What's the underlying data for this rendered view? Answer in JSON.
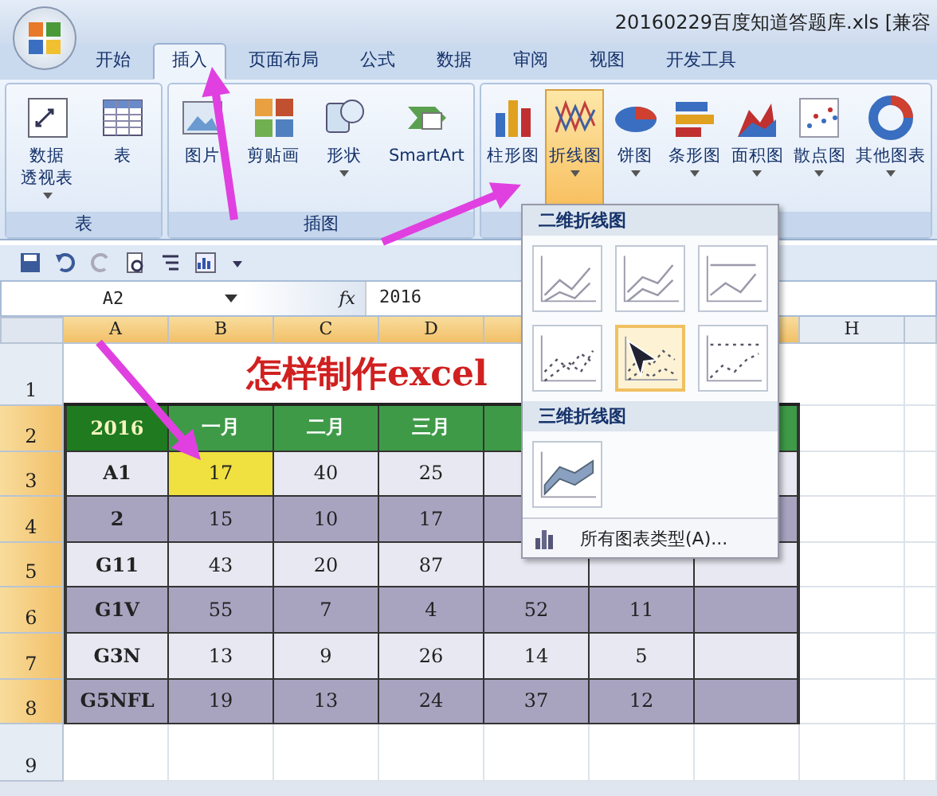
{
  "window": {
    "title": "20160229百度知道答题库.xls [兼容"
  },
  "tabs": [
    {
      "label": "开始",
      "selected": false
    },
    {
      "label": "插入",
      "selected": true
    },
    {
      "label": "页面布局",
      "selected": false
    },
    {
      "label": "公式",
      "selected": false
    },
    {
      "label": "数据",
      "selected": false
    },
    {
      "label": "审阅",
      "selected": false
    },
    {
      "label": "视图",
      "selected": false
    },
    {
      "label": "开发工具",
      "selected": false
    }
  ],
  "ribbon": {
    "groups": [
      {
        "label": "表",
        "buttons": [
          {
            "lines": [
              "数据",
              "透视表"
            ],
            "kind": "pivot",
            "dropdown": true,
            "selected": false
          },
          {
            "label": "表",
            "kind": "table",
            "dropdown": false,
            "selected": false
          }
        ]
      },
      {
        "label": "插图",
        "buttons": [
          {
            "label": "图片",
            "kind": "picture",
            "dropdown": false,
            "selected": false
          },
          {
            "label": "剪贴画",
            "kind": "clipart",
            "dropdown": false,
            "selected": false
          },
          {
            "label": "形状",
            "kind": "shapes",
            "dropdown": true,
            "selected": false
          },
          {
            "label": "SmartArt",
            "kind": "smartart",
            "dropdown": false,
            "selected": false
          }
        ]
      },
      {
        "buttons": [
          {
            "label": "柱形图",
            "kind": "column",
            "dropdown": false,
            "selected": false
          },
          {
            "label": "折线图",
            "kind": "line",
            "dropdown": true,
            "selected": true
          },
          {
            "label": "饼图",
            "kind": "pie",
            "dropdown": true,
            "selected": false
          },
          {
            "label": "条形图",
            "kind": "bar",
            "dropdown": true,
            "selected": false
          },
          {
            "label": "面积图",
            "kind": "area",
            "dropdown": true,
            "selected": false
          },
          {
            "label": "散点图",
            "kind": "scatter",
            "dropdown": true,
            "selected": false
          },
          {
            "label": "其他图表",
            "kind": "other",
            "dropdown": true,
            "selected": false
          }
        ]
      }
    ]
  },
  "formula_bar": {
    "name_box": "A2",
    "fx": "fx",
    "value": "2016"
  },
  "sheet": {
    "columns": [
      {
        "label": "A",
        "selected": true
      },
      {
        "label": "B",
        "selected": true
      },
      {
        "label": "C",
        "selected": true
      },
      {
        "label": "D",
        "selected": true
      },
      {
        "selected": true
      },
      {
        "label": "H",
        "selected": false
      }
    ],
    "title": "怎样制作excel",
    "rows": [
      {
        "header": "1",
        "selected": false,
        "kind": "title"
      },
      {
        "header": "2",
        "selected": true,
        "kind": "header",
        "cells": [
          {
            "text": "2016",
            "highlighted": false
          },
          {
            "text": "一月",
            "highlighted": false
          },
          {
            "text": "二月",
            "highlighted": false
          },
          {
            "text": "三月",
            "highlighted": false
          }
        ]
      },
      {
        "header": "3",
        "selected": true,
        "kind": "light",
        "cells": [
          {
            "text": "A1",
            "highlighted": false
          },
          {
            "text": "17",
            "highlighted": true
          },
          {
            "text": "40",
            "highlighted": false
          },
          {
            "text": "25",
            "highlighted": false
          }
        ]
      },
      {
        "header": "4",
        "selected": true,
        "kind": "dark",
        "cells": [
          {
            "text": "2",
            "highlighted": false
          },
          {
            "text": "15",
            "highlighted": false
          },
          {
            "text": "10",
            "highlighted": false
          },
          {
            "text": "17",
            "highlighted": false
          }
        ]
      },
      {
        "header": "5",
        "selected": true,
        "kind": "light",
        "cells": [
          {
            "text": "G11",
            "highlighted": false
          },
          {
            "text": "43",
            "highlighted": false
          },
          {
            "text": "20",
            "highlighted": false
          },
          {
            "text": "87",
            "highlighted": false
          }
        ]
      },
      {
        "header": "6",
        "selected": true,
        "kind": "dark",
        "cells": [
          {
            "text": "G1V",
            "highlighted": false
          },
          {
            "text": "55",
            "highlighted": false
          },
          {
            "text": "7",
            "highlighted": false
          },
          {
            "text": "4",
            "highlighted": false
          },
          {
            "text": "52",
            "highlighted": false
          },
          {
            "text": "11",
            "highlighted": false
          }
        ]
      },
      {
        "header": "7",
        "selected": true,
        "kind": "light",
        "cells": [
          {
            "text": "G3N",
            "highlighted": false
          },
          {
            "text": "13",
            "highlighted": false
          },
          {
            "text": "9",
            "highlighted": false
          },
          {
            "text": "26",
            "highlighted": false
          },
          {
            "text": "14",
            "highlighted": false
          },
          {
            "text": "5",
            "highlighted": false
          }
        ]
      },
      {
        "header": "8",
        "selected": true,
        "kind": "dark",
        "cells": [
          {
            "text": "G5NFL",
            "highlighted": false
          },
          {
            "text": "19",
            "highlighted": false
          },
          {
            "text": "13",
            "highlighted": false
          },
          {
            "text": "24",
            "highlighted": false
          },
          {
            "text": "37",
            "highlighted": false
          },
          {
            "text": "12",
            "highlighted": false
          }
        ]
      },
      {
        "header": "9",
        "selected": false,
        "kind": "plain"
      }
    ]
  },
  "chart_menu": {
    "sections": [
      {
        "title": "二维折线图",
        "items": [
          {
            "kind": "line",
            "selected": false
          },
          {
            "kind": "stacked",
            "selected": false
          },
          {
            "kind": "percent",
            "selected": false
          },
          {
            "kind": "line_markers",
            "selected": false
          },
          {
            "kind": "stacked_markers",
            "selected": true
          },
          {
            "kind": "percent_markers",
            "selected": false
          }
        ]
      },
      {
        "title": "三维折线图",
        "items": [
          {
            "kind": "ribbon",
            "selected": false
          }
        ]
      }
    ],
    "footer": "所有图表类型(A)..."
  }
}
